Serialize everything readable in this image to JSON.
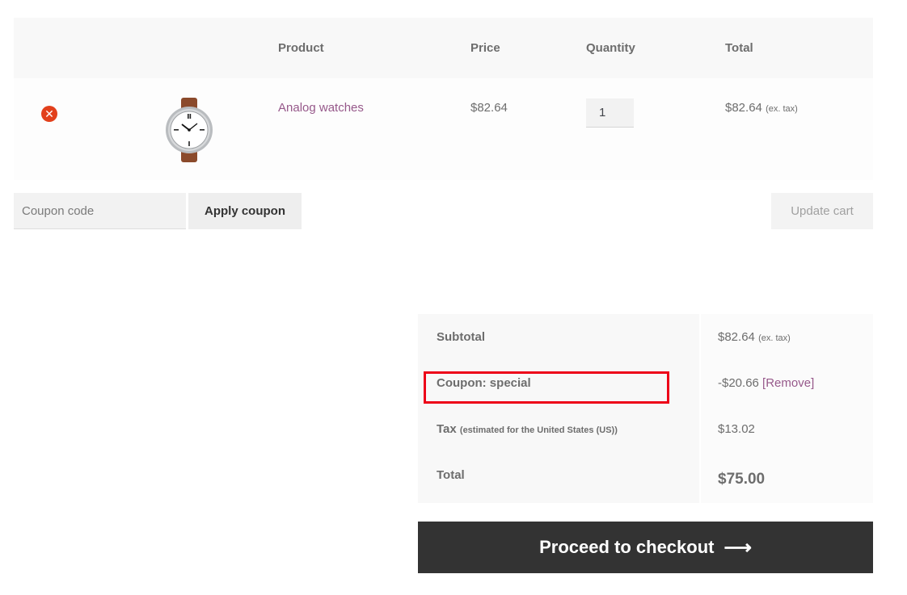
{
  "cart": {
    "headers": {
      "product": "Product",
      "price": "Price",
      "quantity": "Quantity",
      "total": "Total"
    },
    "items": [
      {
        "remove_icon": "remove-circle-icon",
        "name": "Analog watches",
        "price": "$82.64",
        "quantity": "1",
        "total": "$82.64",
        "total_note": "(ex. tax)"
      }
    ]
  },
  "actions": {
    "coupon_placeholder": "Coupon code",
    "apply_label": "Apply coupon",
    "update_label": "Update cart"
  },
  "totals": {
    "subtotal_label": "Subtotal",
    "subtotal_value": "$82.64",
    "subtotal_note": "(ex. tax)",
    "coupon_label": "Coupon: special",
    "coupon_value": "-$20.66",
    "coupon_remove": "[Remove]",
    "tax_label": "Tax",
    "tax_note": "(estimated for the United States (US))",
    "tax_value": "$13.02",
    "total_label": "Total",
    "total_value": "$75.00"
  },
  "checkout": {
    "label": "Proceed to checkout",
    "arrow_icon": "arrow-right-icon"
  },
  "colors": {
    "accent_link": "#96588a",
    "remove_red": "#e2401c",
    "highlight_red": "#ed0018",
    "checkout_bg": "#333333"
  }
}
